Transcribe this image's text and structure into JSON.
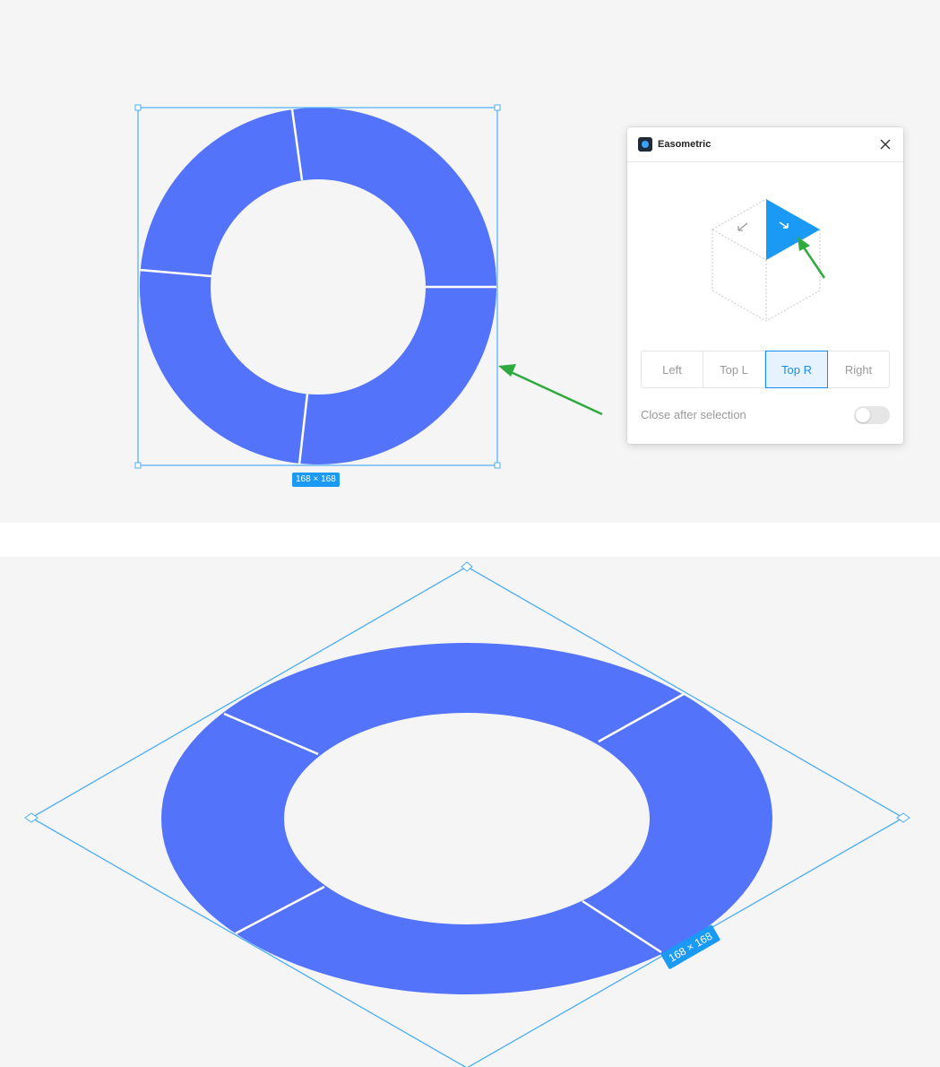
{
  "canvas_top": {
    "size_badge": "168 × 168"
  },
  "canvas_bottom": {
    "size_badge": "168 × 168"
  },
  "plugin": {
    "title": "Easometric",
    "close_icon": "close-icon",
    "cube_icon": "isometric-cube-icon",
    "direction_buttons": [
      {
        "label": "Left",
        "active": false
      },
      {
        "label": "Top L",
        "active": false
      },
      {
        "label": "Top R",
        "active": true
      },
      {
        "label": "Right",
        "active": false
      }
    ],
    "toggle": {
      "label": "Close after selection",
      "on": false
    }
  },
  "colors": {
    "shape_fill": "#5473fb",
    "selection": "#4aaef5",
    "accent": "#1a99f5",
    "arrow": "#2eaa3e",
    "canvas_bg": "#f5f5f5"
  }
}
